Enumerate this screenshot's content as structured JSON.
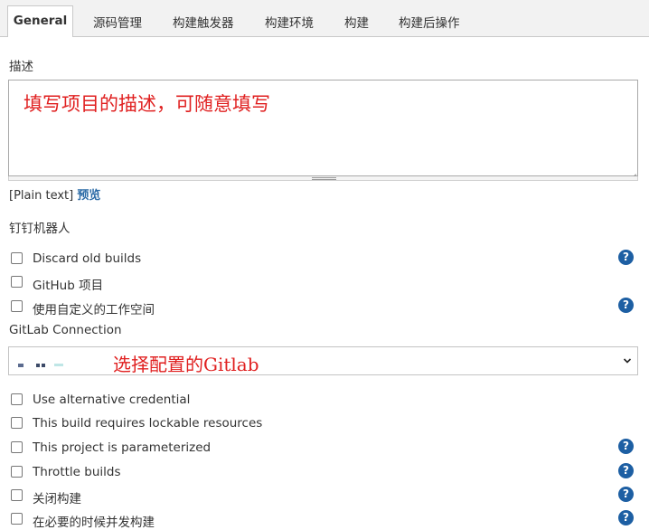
{
  "tabs": [
    {
      "label": "General",
      "active": true
    },
    {
      "label": "源码管理"
    },
    {
      "label": "构建触发器"
    },
    {
      "label": "构建环境"
    },
    {
      "label": "构建"
    },
    {
      "label": "构建后操作"
    }
  ],
  "description": {
    "label": "描述",
    "value": "填写项目的描述，可随意填写",
    "plain_text": "[Plain text]",
    "preview": "预览"
  },
  "dingtalk_label": "钉钉机器人",
  "options_top": [
    {
      "label": "Discard old builds",
      "help": true
    },
    {
      "label": "GitHub 项目",
      "help": false
    },
    {
      "label": "使用自定义的工作空间",
      "help": true
    }
  ],
  "gitlab": {
    "label": "GitLab Connection",
    "selected_value": "选择配置的Gitlab"
  },
  "options_bottom": [
    {
      "label": "Use alternative credential",
      "help": false
    },
    {
      "label": "This build requires lockable resources",
      "help": false
    },
    {
      "label": "This project is parameterized",
      "help": true
    },
    {
      "label": "Throttle builds",
      "help": true
    },
    {
      "label": "关闭构建",
      "help": true
    },
    {
      "label": "在必要的时候并发构建",
      "help": true
    }
  ],
  "help_symbol": "?",
  "colors": {
    "accent": "#1d5fa3",
    "annotation": "#e02020",
    "link": "#2a6aa6"
  }
}
